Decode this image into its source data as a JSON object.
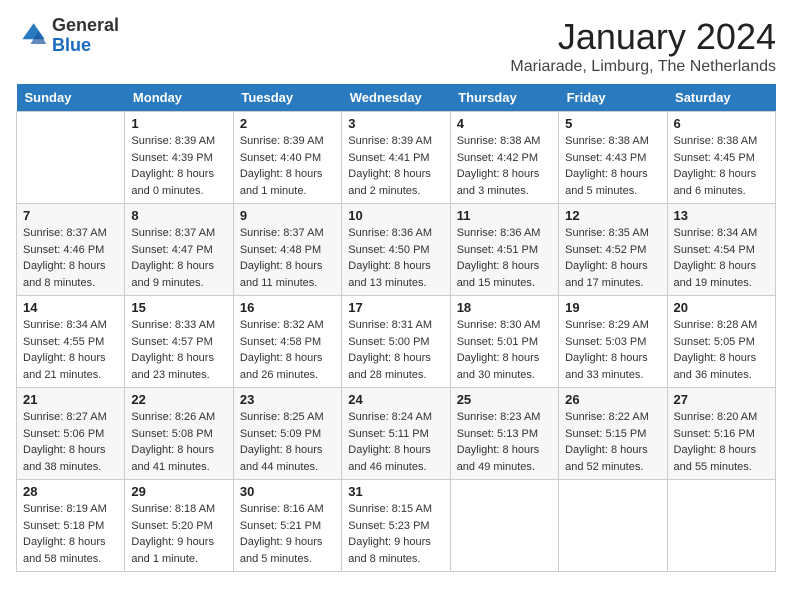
{
  "header": {
    "logo_general": "General",
    "logo_blue": "Blue",
    "month_title": "January 2024",
    "location": "Mariarade, Limburg, The Netherlands"
  },
  "days_of_week": [
    "Sunday",
    "Monday",
    "Tuesday",
    "Wednesday",
    "Thursday",
    "Friday",
    "Saturday"
  ],
  "weeks": [
    [
      {
        "day": "",
        "info": ""
      },
      {
        "day": "1",
        "info": "Sunrise: 8:39 AM\nSunset: 4:39 PM\nDaylight: 8 hours\nand 0 minutes."
      },
      {
        "day": "2",
        "info": "Sunrise: 8:39 AM\nSunset: 4:40 PM\nDaylight: 8 hours\nand 1 minute."
      },
      {
        "day": "3",
        "info": "Sunrise: 8:39 AM\nSunset: 4:41 PM\nDaylight: 8 hours\nand 2 minutes."
      },
      {
        "day": "4",
        "info": "Sunrise: 8:38 AM\nSunset: 4:42 PM\nDaylight: 8 hours\nand 3 minutes."
      },
      {
        "day": "5",
        "info": "Sunrise: 8:38 AM\nSunset: 4:43 PM\nDaylight: 8 hours\nand 5 minutes."
      },
      {
        "day": "6",
        "info": "Sunrise: 8:38 AM\nSunset: 4:45 PM\nDaylight: 8 hours\nand 6 minutes."
      }
    ],
    [
      {
        "day": "7",
        "info": "Sunrise: 8:37 AM\nSunset: 4:46 PM\nDaylight: 8 hours\nand 8 minutes."
      },
      {
        "day": "8",
        "info": "Sunrise: 8:37 AM\nSunset: 4:47 PM\nDaylight: 8 hours\nand 9 minutes."
      },
      {
        "day": "9",
        "info": "Sunrise: 8:37 AM\nSunset: 4:48 PM\nDaylight: 8 hours\nand 11 minutes."
      },
      {
        "day": "10",
        "info": "Sunrise: 8:36 AM\nSunset: 4:50 PM\nDaylight: 8 hours\nand 13 minutes."
      },
      {
        "day": "11",
        "info": "Sunrise: 8:36 AM\nSunset: 4:51 PM\nDaylight: 8 hours\nand 15 minutes."
      },
      {
        "day": "12",
        "info": "Sunrise: 8:35 AM\nSunset: 4:52 PM\nDaylight: 8 hours\nand 17 minutes."
      },
      {
        "day": "13",
        "info": "Sunrise: 8:34 AM\nSunset: 4:54 PM\nDaylight: 8 hours\nand 19 minutes."
      }
    ],
    [
      {
        "day": "14",
        "info": "Sunrise: 8:34 AM\nSunset: 4:55 PM\nDaylight: 8 hours\nand 21 minutes."
      },
      {
        "day": "15",
        "info": "Sunrise: 8:33 AM\nSunset: 4:57 PM\nDaylight: 8 hours\nand 23 minutes."
      },
      {
        "day": "16",
        "info": "Sunrise: 8:32 AM\nSunset: 4:58 PM\nDaylight: 8 hours\nand 26 minutes."
      },
      {
        "day": "17",
        "info": "Sunrise: 8:31 AM\nSunset: 5:00 PM\nDaylight: 8 hours\nand 28 minutes."
      },
      {
        "day": "18",
        "info": "Sunrise: 8:30 AM\nSunset: 5:01 PM\nDaylight: 8 hours\nand 30 minutes."
      },
      {
        "day": "19",
        "info": "Sunrise: 8:29 AM\nSunset: 5:03 PM\nDaylight: 8 hours\nand 33 minutes."
      },
      {
        "day": "20",
        "info": "Sunrise: 8:28 AM\nSunset: 5:05 PM\nDaylight: 8 hours\nand 36 minutes."
      }
    ],
    [
      {
        "day": "21",
        "info": "Sunrise: 8:27 AM\nSunset: 5:06 PM\nDaylight: 8 hours\nand 38 minutes."
      },
      {
        "day": "22",
        "info": "Sunrise: 8:26 AM\nSunset: 5:08 PM\nDaylight: 8 hours\nand 41 minutes."
      },
      {
        "day": "23",
        "info": "Sunrise: 8:25 AM\nSunset: 5:09 PM\nDaylight: 8 hours\nand 44 minutes."
      },
      {
        "day": "24",
        "info": "Sunrise: 8:24 AM\nSunset: 5:11 PM\nDaylight: 8 hours\nand 46 minutes."
      },
      {
        "day": "25",
        "info": "Sunrise: 8:23 AM\nSunset: 5:13 PM\nDaylight: 8 hours\nand 49 minutes."
      },
      {
        "day": "26",
        "info": "Sunrise: 8:22 AM\nSunset: 5:15 PM\nDaylight: 8 hours\nand 52 minutes."
      },
      {
        "day": "27",
        "info": "Sunrise: 8:20 AM\nSunset: 5:16 PM\nDaylight: 8 hours\nand 55 minutes."
      }
    ],
    [
      {
        "day": "28",
        "info": "Sunrise: 8:19 AM\nSunset: 5:18 PM\nDaylight: 8 hours\nand 58 minutes."
      },
      {
        "day": "29",
        "info": "Sunrise: 8:18 AM\nSunset: 5:20 PM\nDaylight: 9 hours\nand 1 minute."
      },
      {
        "day": "30",
        "info": "Sunrise: 8:16 AM\nSunset: 5:21 PM\nDaylight: 9 hours\nand 5 minutes."
      },
      {
        "day": "31",
        "info": "Sunrise: 8:15 AM\nSunset: 5:23 PM\nDaylight: 9 hours\nand 8 minutes."
      },
      {
        "day": "",
        "info": ""
      },
      {
        "day": "",
        "info": ""
      },
      {
        "day": "",
        "info": ""
      }
    ]
  ]
}
